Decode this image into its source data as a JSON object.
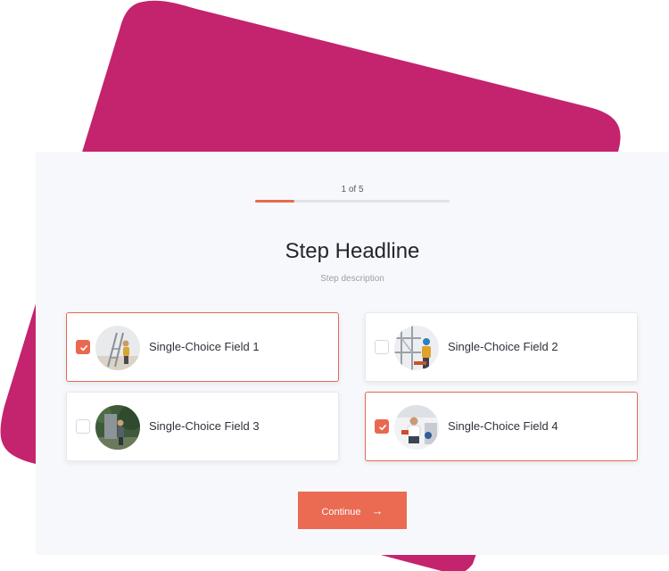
{
  "progress": {
    "label": "1 of 5",
    "fraction": 0.2
  },
  "step": {
    "headline": "Step Headline",
    "description": "Step description"
  },
  "options": [
    {
      "label": "Single-Choice Field 1",
      "checked": true,
      "image": "worker-on-ladder-photo"
    },
    {
      "label": "Single-Choice Field 2",
      "checked": false,
      "image": "scaffolding-worker-photo"
    },
    {
      "label": "Single-Choice Field 3",
      "checked": false,
      "image": "garden-worker-photo"
    },
    {
      "label": "Single-Choice Field 4",
      "checked": true,
      "image": "tradesman-kneeling-photo"
    }
  ],
  "continue_button": {
    "label": "Continue",
    "arrow": "→"
  },
  "colors": {
    "accent": "#e8694f",
    "background_shape": "#c4236d",
    "card": "#f7f8fb"
  }
}
